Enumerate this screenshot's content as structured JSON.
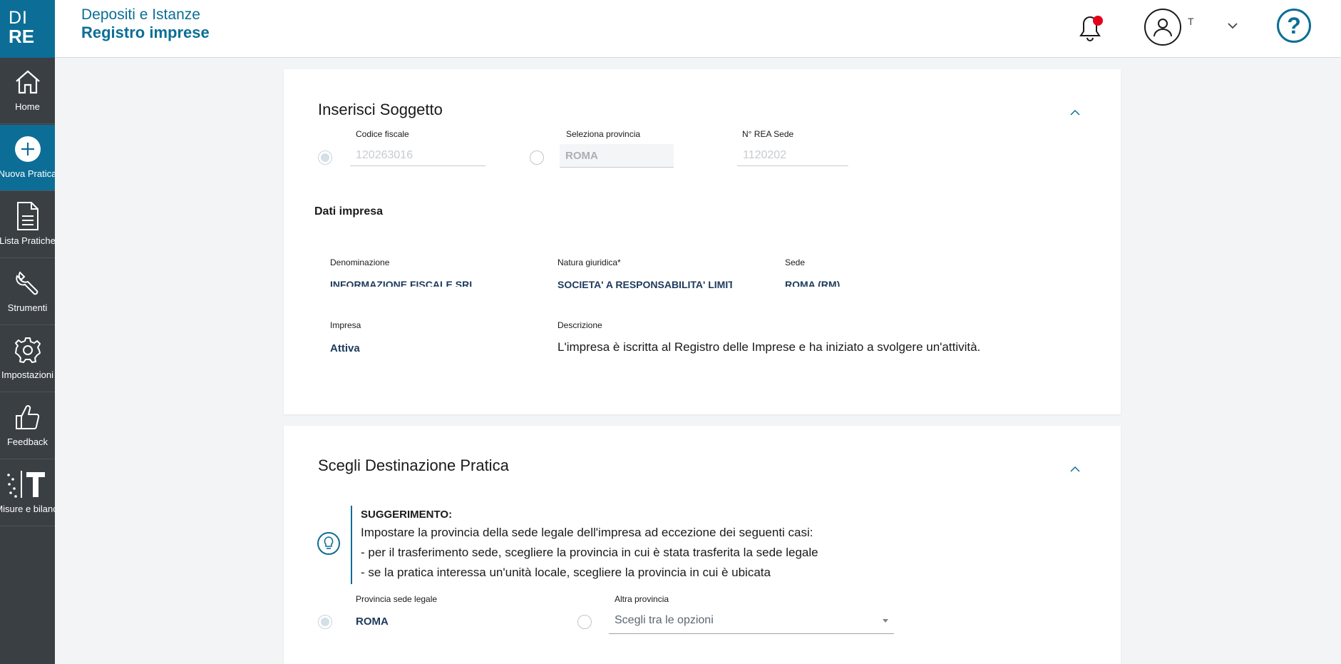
{
  "logo": {
    "line1": "DI",
    "line2": "RE"
  },
  "sidebar": {
    "items": [
      {
        "label": "Home",
        "icon": "home-icon"
      },
      {
        "label": "Nuova Pratica",
        "icon": "plus-circle-icon"
      },
      {
        "label": "Lista Pratiche",
        "icon": "document-icon"
      },
      {
        "label": "Strumenti",
        "icon": "wrench-icon"
      },
      {
        "label": "Impostazioni",
        "icon": "gear-icon"
      },
      {
        "label": "Feedback",
        "icon": "thumbs-up-icon"
      },
      {
        "label": "Misure e bilanci",
        "icon": "t-brand-icon"
      }
    ]
  },
  "header": {
    "title_line1": "Depositi e Istanze",
    "title_line2": "Registro imprese",
    "username": "T",
    "help": "?"
  },
  "colors": {
    "brand": "#0c6e96",
    "sidebar": "#3a3f44",
    "notification": "#e4001b"
  },
  "inserisci": {
    "title": "Inserisci Soggetto",
    "codice_fiscale_label": "Codice fiscale",
    "codice_fiscale_value": "120263016",
    "provincia_label": "Seleziona provincia",
    "provincia_value": "ROMA",
    "rea_label": "N° REA Sede",
    "rea_value": "1120202",
    "dati_impresa": "Dati impresa",
    "denominazione_label": "Denominazione",
    "denominazione_value": "INFORMAZIONE FISCALE SRL",
    "natura_label": "Natura giuridica*",
    "natura_value": "SOCIETA' A RESPONSABILITA' LIMIT",
    "sede_label": "Sede",
    "sede_value": "ROMA (RM)",
    "impresa_label": "Impresa",
    "impresa_value": "Attiva",
    "descrizione_label": "Descrizione",
    "descrizione_value": "L'impresa è iscritta al Registro delle Imprese e ha iniziato a svolgere un'attività."
  },
  "destinazione": {
    "title": "Scegli Destinazione Pratica",
    "hint_title": "SUGGERIMENTO:",
    "hint_lines": [
      "Impostare la provincia della sede legale dell'impresa ad eccezione dei seguenti casi:",
      "- per il trasferimento sede, scegliere la provincia in cui è stata trasferita la sede legale",
      "- se la pratica interessa un'unità locale, scegliere la provincia in cui è ubicata"
    ],
    "provincia_sede_label": "Provincia sede legale",
    "provincia_sede_value": "ROMA",
    "altra_label": "Altra provincia",
    "altra_placeholder": "Scegli tra le opzioni"
  }
}
